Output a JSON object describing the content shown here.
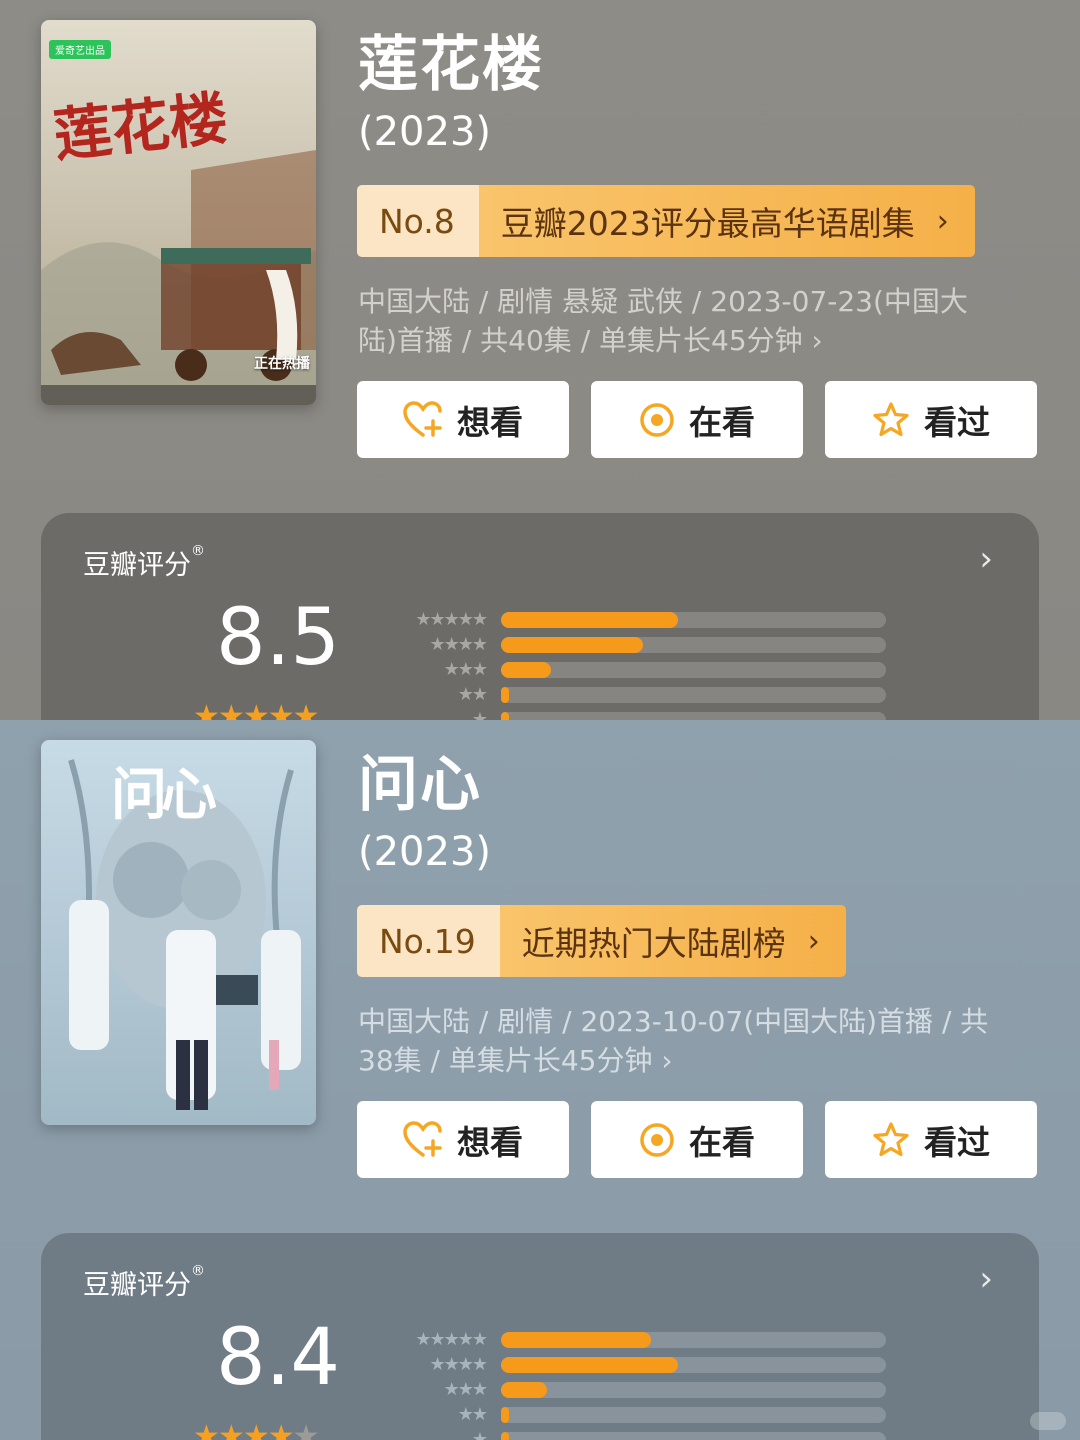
{
  "shows": [
    {
      "poster": {
        "calligraphy": "莲花楼",
        "ribbon": "正在热播",
        "badge": "爱奇艺出品",
        "bg_top": "#ded8c8",
        "bg_bottom": "#b7ad96",
        "title_color": "#b3261e"
      },
      "title": "莲花楼",
      "year": "(2023)",
      "rank": {
        "no": "No.8",
        "label": "豆瓣2023评分最高华语剧集",
        "chevron": "›"
      },
      "meta_line1": "中国大陆 / 剧情 悬疑 武侠 / 2023-07-23(中国大",
      "meta_line2": "陆)首播 / 共40集 / 单集片长45分钟 ›",
      "actions": [
        {
          "label": "想看",
          "icon": "heart-plus-icon"
        },
        {
          "label": "在看",
          "icon": "target-icon"
        },
        {
          "label": "看过",
          "icon": "star-outline-icon"
        }
      ],
      "rating": {
        "heading": "豆瓣评分",
        "reg": "®",
        "chevron": "›",
        "score": "8.5",
        "stars_filled": 4.5,
        "distribution": [
          0.46,
          0.37,
          0.13,
          0.02,
          0.02
        ]
      }
    },
    {
      "poster": {
        "calligraphy": "问心",
        "ribbon": "",
        "badge": "",
        "bg_top": "#c9dce6",
        "bg_bottom": "#9fb7c5",
        "title_color": "#ffffff"
      },
      "title": "问心",
      "year": "(2023)",
      "rank": {
        "no": "No.19",
        "label": "近期热门大陆剧榜",
        "chevron": "›"
      },
      "meta_line1": "中国大陆 / 剧情 / 2023-10-07(中国大陆)首播 / 共",
      "meta_line2": "38集 / 单集片长45分钟 ›",
      "actions": [
        {
          "label": "想看",
          "icon": "heart-plus-icon"
        },
        {
          "label": "在看",
          "icon": "target-icon"
        },
        {
          "label": "看过",
          "icon": "star-outline-icon"
        }
      ],
      "rating": {
        "heading": "豆瓣评分",
        "reg": "®",
        "chevron": "›",
        "score": "8.4",
        "stars_filled": 4,
        "distribution": [
          0.39,
          0.46,
          0.12,
          0.02,
          0.02
        ]
      }
    }
  ],
  "colors": {
    "accent_orange": "#f59a1b",
    "rank_badge": "#f9c46b",
    "icon_orange": "#f5a623"
  }
}
